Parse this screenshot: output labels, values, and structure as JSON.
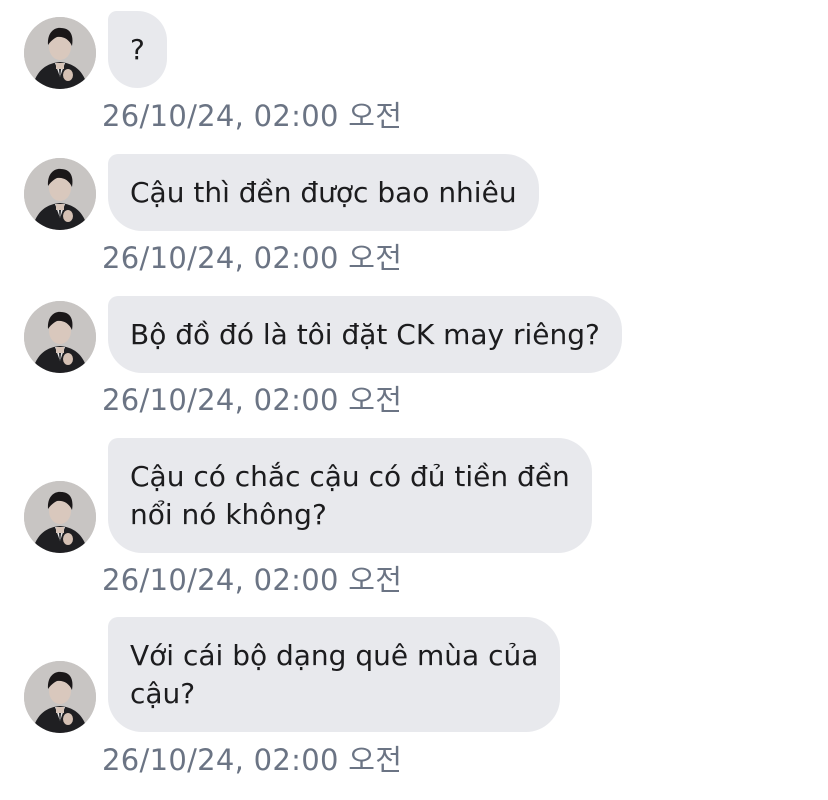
{
  "messages": [
    {
      "text": "?",
      "time": "26/10/24, 02:00 오전"
    },
    {
      "text": "Cậu thì đền được bao nhiêu",
      "time": "26/10/24, 02:00 오전"
    },
    {
      "text": "Bộ đồ đó là tôi đặt CK may riêng?",
      "time": "26/10/24, 02:00 오전"
    },
    {
      "text": "Cậu có chắc cậu có đủ tiền đền\nnổi nó không?",
      "time": "26/10/24, 02:00 오전"
    },
    {
      "text": "Với cái bộ dạng quê mùa của\ncậu?",
      "time": "26/10/24, 02:00 오전"
    }
  ]
}
